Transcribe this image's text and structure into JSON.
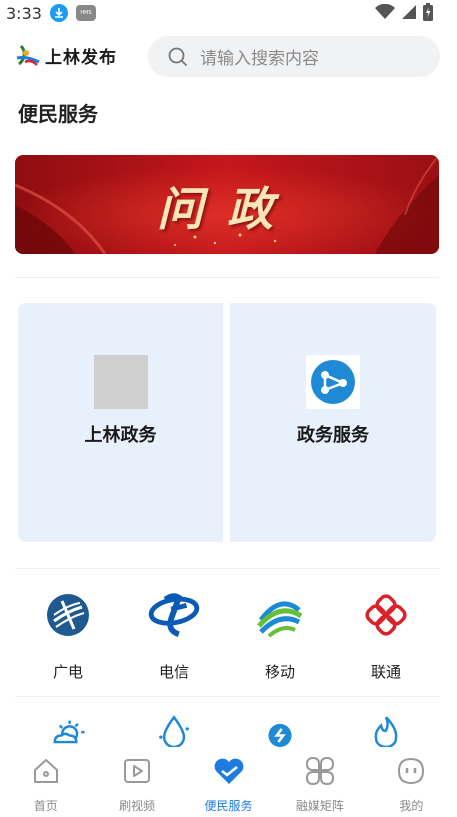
{
  "status_bar": {
    "time": "3:33",
    "hms_label": "HMS"
  },
  "header": {
    "logo_text": "上林发布",
    "search_placeholder": "请输入搜索内容"
  },
  "page_title": "便民服务",
  "banner": {
    "text": "问政"
  },
  "cards": [
    {
      "label": "上林政务"
    },
    {
      "label": "政务服务"
    }
  ],
  "services": [
    {
      "label": "广电",
      "icon": "broadcast-icon",
      "color": "#1e5a8f"
    },
    {
      "label": "电信",
      "icon": "telecom-icon",
      "color": "#0a5bb5"
    },
    {
      "label": "移动",
      "icon": "mobile-icon",
      "color": "#1a8ad8"
    },
    {
      "label": "联通",
      "icon": "unicom-icon",
      "color": "#d8232a"
    }
  ],
  "bottom_nav": [
    {
      "label": "首页",
      "icon": "home-icon",
      "active": false
    },
    {
      "label": "刷视频",
      "icon": "video-icon",
      "active": false
    },
    {
      "label": "便民服务",
      "icon": "heart-icon",
      "active": true
    },
    {
      "label": "融媒矩阵",
      "icon": "grid-icon",
      "active": false
    },
    {
      "label": "我的",
      "icon": "profile-icon",
      "active": false
    }
  ],
  "colors": {
    "accent": "#1e7be0",
    "card_bg": "#e8f1fb",
    "banner_red": "#c4161c"
  }
}
